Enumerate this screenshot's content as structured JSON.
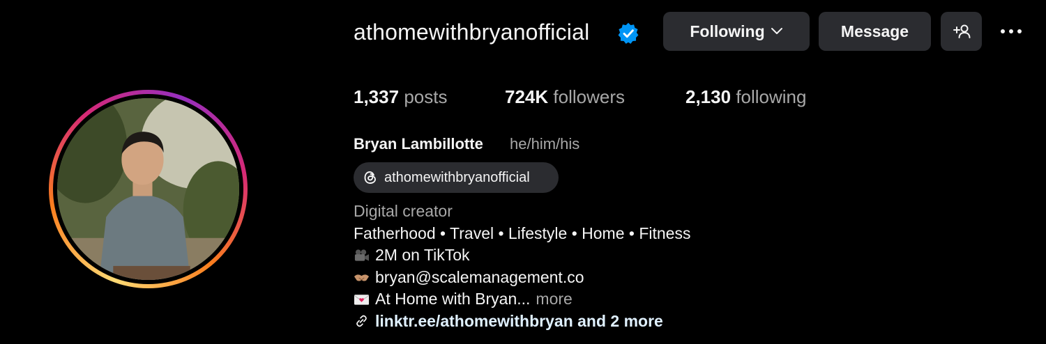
{
  "profile": {
    "username": "athomewithbryanofficial",
    "verified": true,
    "verified_icon": "verified-badge-icon",
    "full_name": "Bryan Lambillotte",
    "pronouns": "he/him/his",
    "avatar_alt": "profile photo"
  },
  "actions": {
    "following_label": "Following",
    "message_label": "Message",
    "add_user_icon": "add-person-icon",
    "more_icon": "more-horizontal-icon"
  },
  "stats": {
    "posts_count": "1,337",
    "posts_label": "posts",
    "followers_count": "724K",
    "followers_label": "followers",
    "following_count": "2,130",
    "following_label": "following"
  },
  "threads": {
    "handle": "athomewithbryanofficial",
    "icon": "threads-icon"
  },
  "bio": {
    "category": "Digital creator",
    "line1": "Fatherhood • Travel • Lifestyle • Home • Fitness",
    "line2": "2M on TikTok",
    "line2_icon": "movie-camera-icon",
    "line3": "bryan@scalemanagement.co",
    "line3_icon": "handshake-icon",
    "line4": "At Home with Bryan...",
    "line4_icon": "love-letter-icon",
    "more_label": "more",
    "link": "linktr.ee/athomewithbryan and 2 more",
    "link_icon": "link-icon"
  },
  "colors": {
    "background": "#000000",
    "button_bg": "#2b2c30",
    "verified_blue": "#0095f6",
    "muted_text": "#a8a8a8",
    "link_text": "#e0f1ff"
  }
}
